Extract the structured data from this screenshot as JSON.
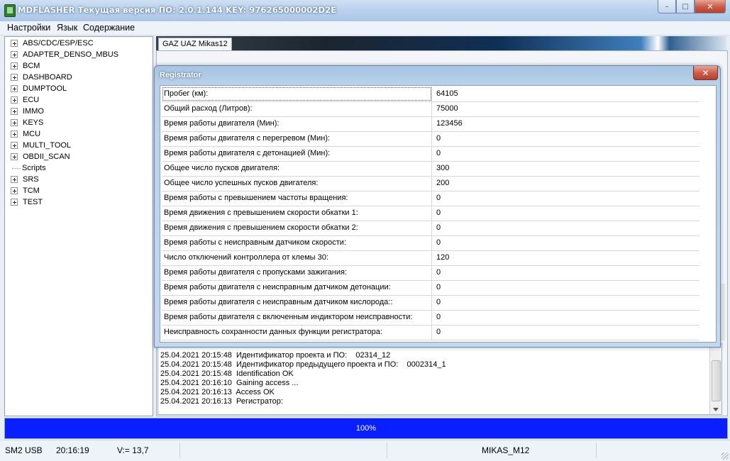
{
  "window": {
    "title": "MDFLASHER  Текущая версия ПО: 2.0.1.144  KEY: 976265000002D2E",
    "buttons": {
      "minimize": "–",
      "maximize": "□",
      "close": "✕"
    }
  },
  "menu": [
    "Настройки",
    "Язык",
    "Содержание"
  ],
  "tree": [
    {
      "label": "ABS/CDC/ESP/ESC",
      "expandable": true
    },
    {
      "label": "ADAPTER_DENSO_MBUS",
      "expandable": true
    },
    {
      "label": "BCM",
      "expandable": true
    },
    {
      "label": "DASHBOARD",
      "expandable": true
    },
    {
      "label": "DUMPTOOL",
      "expandable": true
    },
    {
      "label": "ECU",
      "expandable": true
    },
    {
      "label": "IMMO",
      "expandable": true
    },
    {
      "label": "KEYS",
      "expandable": true
    },
    {
      "label": "MCU",
      "expandable": true
    },
    {
      "label": "MULTI_TOOL",
      "expandable": true
    },
    {
      "label": "OBDII_SCAN",
      "expandable": true
    },
    {
      "label": "Scripts",
      "expandable": false
    },
    {
      "label": "SRS",
      "expandable": true
    },
    {
      "label": "TCM",
      "expandable": true
    },
    {
      "label": "TEST",
      "expandable": true
    }
  ],
  "tab": {
    "label": "GAZ UAZ Mikas12"
  },
  "dialog": {
    "title": "Registrator",
    "close": "✕",
    "rows": [
      {
        "label": "Пробег (км):",
        "value": "64105"
      },
      {
        "label": "Общий расход (Литров):",
        "value": "75000"
      },
      {
        "label": "Время работы двигателя (Мин):",
        "value": "123456"
      },
      {
        "label": "Время работы двигателя с перегревом (Мин):",
        "value": "0"
      },
      {
        "label": "Время работы двигателя с детонацией (Мин):",
        "value": "0"
      },
      {
        "label": "Общее число пусков двигателя:",
        "value": "300"
      },
      {
        "label": "Общее число успешных пусков двигателя:",
        "value": "200"
      },
      {
        "label": "Время работы с превышением частоты вращения:",
        "value": "0"
      },
      {
        "label": "Время движения с превышением скорости обкатки 1:",
        "value": "0"
      },
      {
        "label": "Время движения с превышением скорости обкатки 2:",
        "value": "0"
      },
      {
        "label": "Время работы с неисправным датчиком скорости:",
        "value": "0"
      },
      {
        "label": "Число отключений контроллера от клемы 30:",
        "value": "120"
      },
      {
        "label": "Время работы двигателя с пропусками зажигания:",
        "value": "0"
      },
      {
        "label": "Время работы двигателя с неисправным датчиком детонации:",
        "value": "0"
      },
      {
        "label": "Время работы двигателя с неисправным датчиком кислорода::",
        "value": "0"
      },
      {
        "label": "Время работы двигателя с включенным индиктором неисправности:",
        "value": "0"
      },
      {
        "label": "Неисправность сохранности данных функции регистратора:",
        "value": "0"
      }
    ]
  },
  "log": [
    "25.04.2021 20:15:48  Идентификатор проекта и ПО:    02314_12",
    "25.04.2021 20:15:48  Идентификатор предыдущего проекта и ПО:    0002314_1",
    "25.04.2021 20:15:48  Identification OK",
    "25.04.2021 20:16:10  Gaining access ...",
    "25.04.2021 20:16:13  Access OK",
    "25.04.2021 20:16:13  Регистратор:"
  ],
  "progress": {
    "value": 1.0,
    "label": "100%"
  },
  "status": {
    "port": "SM2 USB",
    "time": "20:16:19",
    "voltage": "V:= 13,7",
    "ecu": "MIKAS_M12"
  }
}
